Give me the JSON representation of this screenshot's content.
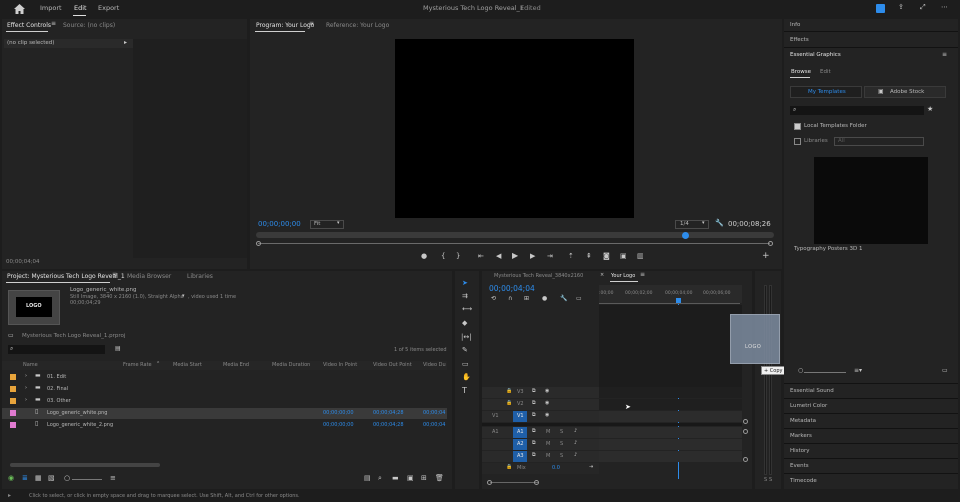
{
  "topbar": {
    "home": "home-icon",
    "import": "Import",
    "edit": "Edit",
    "export": "Export",
    "title": "Mysterious Tech Logo Reveal_1",
    "edited": "Edited"
  },
  "effect_controls": {
    "tab": "Effect Controls",
    "source_tab": "Source: (no clips)",
    "no_clip": "(no clip selected)",
    "timecode": "00;00;04;04"
  },
  "program": {
    "tab": "Program: Your Logo",
    "ref_tab": "Reference: Your Logo",
    "timecode": "00;00;00;00",
    "fit": "Fit",
    "ratio": "1/4",
    "duration": "00;00;08;26"
  },
  "project": {
    "tab": "Project: Mysterious Tech Logo Reveal_1",
    "media_browser": "Media Browser",
    "libraries": "Libraries",
    "thumb_text": "LOGO",
    "file_name": "Logo_generic_white.png",
    "file_info1": "Still Image, 3840 x 2160 (1.0), Straight Alpha",
    "file_info2": ", video used 1 time",
    "file_duration": "00;00;04;29",
    "project_file": "Mysterious Tech Logo Reveal_1.prproj",
    "selection": "1 of 5 items selected",
    "columns": [
      "Name",
      "Frame Rate",
      "Media Start",
      "Media End",
      "Media Duration",
      "Video In Point",
      "Video Out Point",
      "Video Du"
    ],
    "rows": [
      {
        "name": "01. Edit",
        "type": "bin",
        "color": "#e8a43b"
      },
      {
        "name": "02. Final",
        "type": "bin",
        "color": "#e8a43b"
      },
      {
        "name": "03. Other",
        "type": "bin",
        "color": "#e8a43b"
      },
      {
        "name": "Logo_generic_white.png",
        "type": "file",
        "color": "#e07ad0",
        "in": "00;00;00;00",
        "out": "00;00;04;28",
        "dur": "00;00;04"
      },
      {
        "name": "Logo_generic_white_2.png",
        "type": "file",
        "color": "#e07ad0",
        "in": "00;00;00;00",
        "out": "00;00;04;28",
        "dur": "00;00;04"
      }
    ]
  },
  "timeline": {
    "tab1": "Mysterious Tech Reveal_3840x2160",
    "tab2": "Your Logo",
    "timecode": "00;00;04;04",
    "ruler": [
      ":00;00",
      "00;00;02;00",
      "00;00;04;00",
      "00;00;06;00"
    ],
    "tracks": [
      {
        "name": "V3"
      },
      {
        "name": "V2"
      },
      {
        "name": "V1",
        "src": "V1"
      },
      {
        "name": "A1",
        "src": "A1"
      },
      {
        "name": "A2"
      },
      {
        "name": "A3"
      }
    ],
    "mix": "Mix",
    "mix_val": "0.0",
    "drag_label": "LOGO",
    "copy_tooltip": "Copy",
    "meter_labels": [
      "S",
      "S"
    ]
  },
  "right_panel": {
    "info": "Info",
    "effects": "Effects",
    "essential_graphics": "Essential Graphics",
    "browse": "Browse",
    "edit": "Edit",
    "my_templates": "My Templates",
    "adobe_stock": "Adobe Stock",
    "local_folder": "Local Templates Folder",
    "libraries": "Libraries",
    "libraries_val": "All",
    "template_name": "Typography Posters 3D 1",
    "collapsed": [
      "Essential Sound",
      "Lumetri Color",
      "Metadata",
      "Markers",
      "History",
      "Events",
      "Timecode"
    ]
  },
  "status": "Click to select, or click in empty space and drag to marquee select. Use Shift, Alt, and Ctrl for other options.",
  "colors": {
    "accent": "#2d8ceb",
    "bin": "#e8a43b",
    "file": "#e07ad0"
  }
}
